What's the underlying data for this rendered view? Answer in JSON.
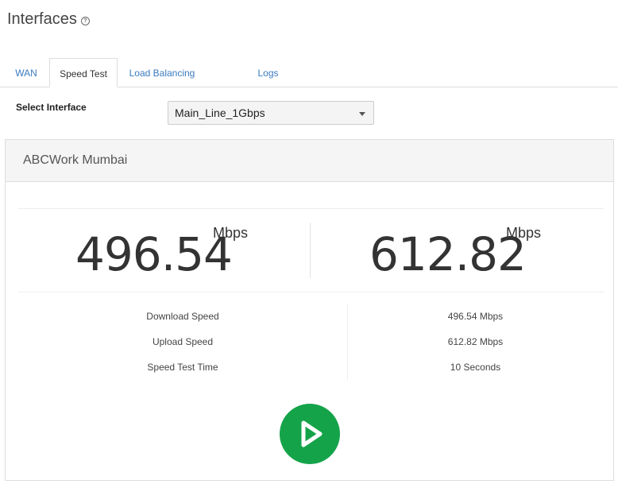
{
  "header": {
    "title": "Interfaces",
    "help_icon": "question-circle-icon"
  },
  "tabs": [
    {
      "label": "WAN",
      "active": false
    },
    {
      "label": "Speed Test",
      "active": true
    },
    {
      "label": "Load Balancing",
      "active": false
    },
    {
      "label": "Logs",
      "active": false
    }
  ],
  "interface_select": {
    "label": "Select Interface",
    "value": "Main_Line_1Gbps"
  },
  "panel": {
    "title": "ABCWork Mumbai",
    "download": {
      "value": "496.54",
      "unit": "Mbps"
    },
    "upload": {
      "value": "612.82",
      "unit": "Mbps"
    },
    "stats": [
      {
        "label": "Download Speed",
        "value": "496.54 Mbps"
      },
      {
        "label": "Upload Speed",
        "value": "612.82 Mbps"
      },
      {
        "label": "Speed Test Time",
        "value": "10 Seconds"
      }
    ],
    "start_button": {
      "icon": "play-icon",
      "color": "#15a34a"
    }
  }
}
